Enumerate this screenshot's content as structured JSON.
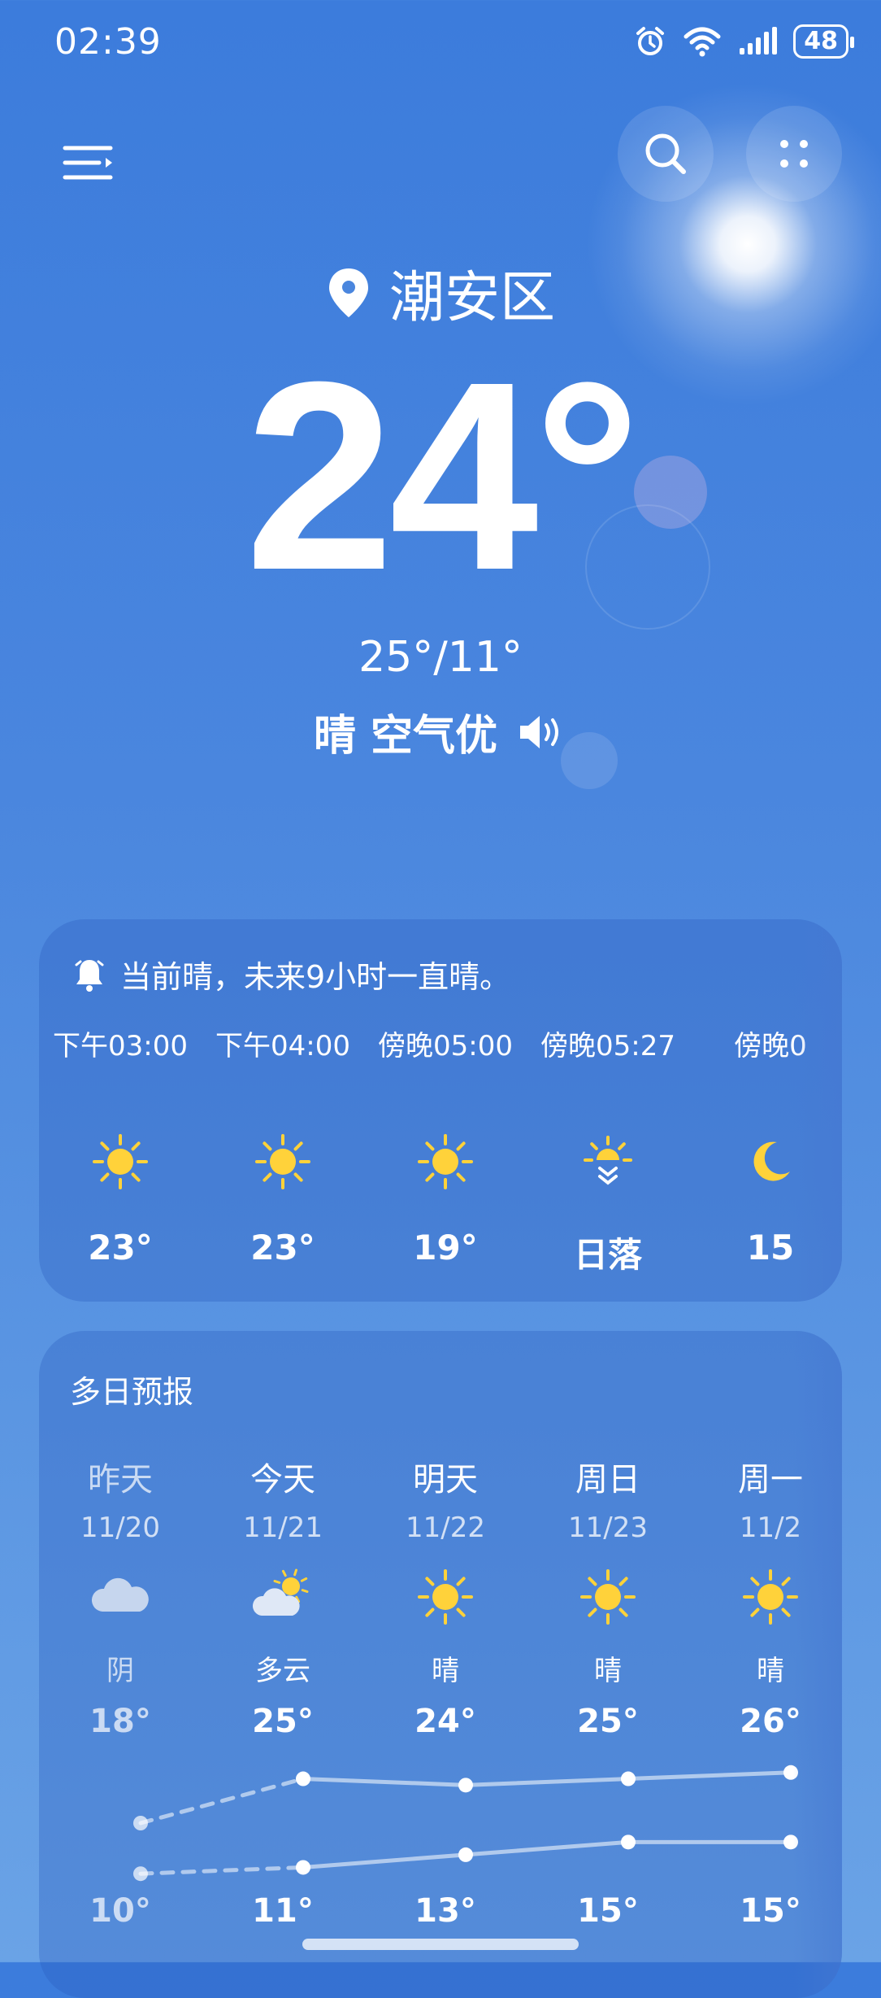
{
  "status_bar": {
    "time": "02:39",
    "battery": "48",
    "icons": [
      "alarm-icon",
      "wifi-icon",
      "signal-icon",
      "battery-icon"
    ]
  },
  "header": {
    "location": "潮安区",
    "current_temp": "24°",
    "range": "25°/11°",
    "condition": "晴 空气优"
  },
  "hourly": {
    "alert": "当前晴，未来9小时一直晴。",
    "items": [
      {
        "label": "下午03:00",
        "icon": "sun-icon",
        "temp": "23°"
      },
      {
        "label": "下午04:00",
        "icon": "sun-icon",
        "temp": "23°"
      },
      {
        "label": "傍晚05:00",
        "icon": "sun-icon",
        "temp": "19°"
      },
      {
        "label": "傍晚05:27",
        "icon": "sunset-icon",
        "temp": "日落"
      },
      {
        "label": "傍晚0",
        "icon": "moon-icon",
        "temp": "15"
      }
    ]
  },
  "daily": {
    "title": "多日预报",
    "items": [
      {
        "name": "昨天",
        "date": "11/20",
        "icon": "cloud-icon",
        "cond": "阴",
        "high": "18°",
        "low": "10°",
        "high_value": 18,
        "low_value": 10,
        "past": true
      },
      {
        "name": "今天",
        "date": "11/21",
        "icon": "partly-cloudy-icon",
        "cond": "多云",
        "high": "25°",
        "low": "11°",
        "high_value": 25,
        "low_value": 11,
        "past": false
      },
      {
        "name": "明天",
        "date": "11/22",
        "icon": "sun-icon",
        "cond": "晴",
        "high": "24°",
        "low": "13°",
        "high_value": 24,
        "low_value": 13,
        "past": false
      },
      {
        "name": "周日",
        "date": "11/23",
        "icon": "sun-icon",
        "cond": "晴",
        "high": "25°",
        "low": "15°",
        "high_value": 25,
        "low_value": 15,
        "past": false
      },
      {
        "name": "周一",
        "date": "11/2",
        "icon": "sun-icon",
        "cond": "晴",
        "high": "26°",
        "low": "15°",
        "high_value": 26,
        "low_value": 15,
        "past": false
      }
    ]
  },
  "colors": {
    "sun": "#ffd23a",
    "background_top": "#3c7cdc",
    "card": "rgba(40,90,190,0.32)"
  }
}
